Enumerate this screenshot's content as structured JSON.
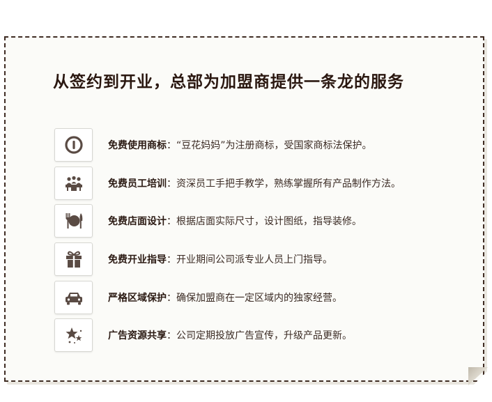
{
  "title": "从签约到开业，总部为加盟商提供一条龙的服务",
  "services": [
    {
      "icon": "power-icon",
      "label": "免费使用商标",
      "sep": "：",
      "desc": "“豆花妈妈”为注册商标，受国家商标法保护。"
    },
    {
      "icon": "team-meeting-icon",
      "label": "免费员工培训",
      "sep": "：",
      "desc": "资深员工手把手教学，熟练掌握所有产品制作方法。"
    },
    {
      "icon": "dining-icon",
      "label": "免费店面设计",
      "sep": "：",
      "desc": "根据店面实际尺寸，设计图纸，指导装修。"
    },
    {
      "icon": "gift-icon",
      "label": "免费开业指导",
      "sep": "：",
      "desc": "开业期间公司派专业人员上门指导。"
    },
    {
      "icon": "car-icon",
      "label": "严格区域保护",
      "sep": "：",
      "desc": "确保加盟商在一定区域内的独家经营。"
    },
    {
      "icon": "stars-icon",
      "label": "广告资源共享",
      "sep": "：",
      "desc": "公司定期投放广告宣传，升级产品更新。"
    }
  ],
  "colors": {
    "icon": "#5a4b44",
    "border": "#3f2c23",
    "title": "#2a1710"
  }
}
